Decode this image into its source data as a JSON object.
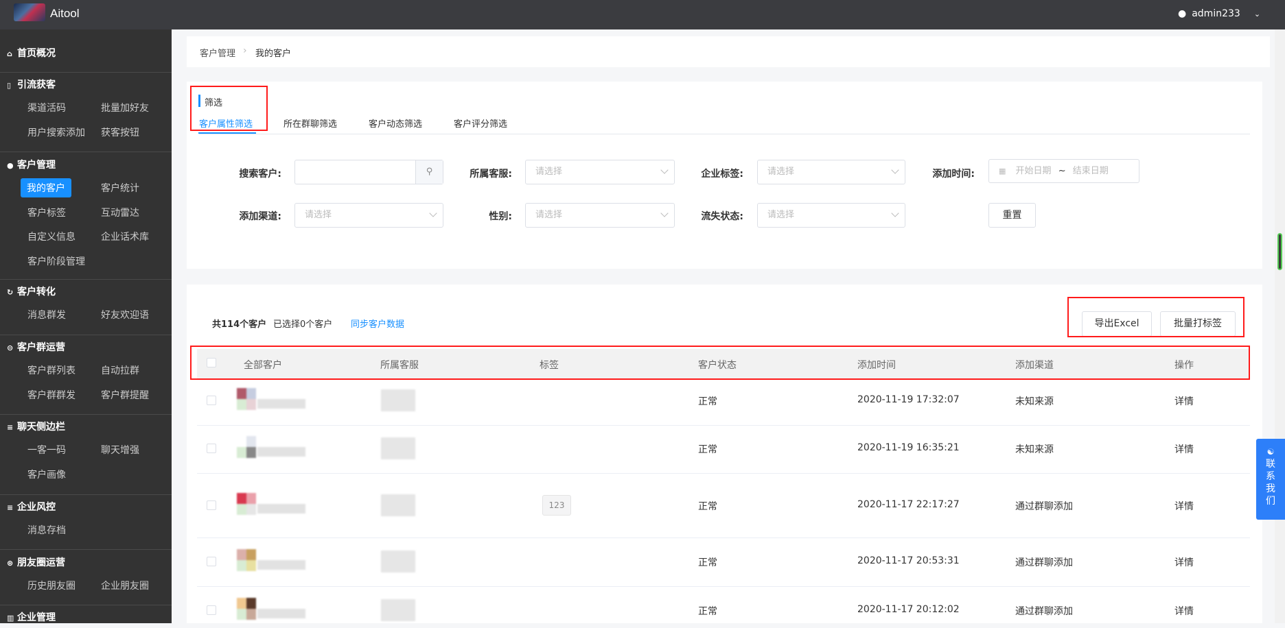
{
  "header": {
    "app_name": "Aitool",
    "username": "admin233"
  },
  "sidebar": {
    "sections": [
      {
        "icon": "home-icon",
        "glyph": "⌂",
        "label": "首页概况",
        "items": []
      },
      {
        "icon": "bookmark-icon",
        "glyph": "▯",
        "label": "引流获客",
        "items": [
          "渠道活码",
          "批量加好友",
          "用户搜索添加",
          "获客按钮"
        ]
      },
      {
        "icon": "user-icon",
        "glyph": "●",
        "label": "客户管理",
        "items": [
          "我的客户",
          "客户统计",
          "客户标签",
          "互动雷达",
          "自定义信息",
          "企业话术库",
          "客户阶段管理"
        ],
        "active": "我的客户"
      },
      {
        "icon": "refresh-icon",
        "glyph": "↻",
        "label": "客户转化",
        "items": [
          "消息群发",
          "好友欢迎语"
        ]
      },
      {
        "icon": "chat-icon",
        "glyph": "⊝",
        "label": "客户群运营",
        "items": [
          "客户群列表",
          "自动拉群",
          "客户群群发",
          "客户群提醒"
        ]
      },
      {
        "icon": "menu-icon",
        "glyph": "≡",
        "label": "聊天侧边栏",
        "items": [
          "一客一码",
          "聊天增强",
          "客户画像"
        ]
      },
      {
        "icon": "menu-icon",
        "glyph": "≡",
        "label": "企业风控",
        "items": [
          "消息存档"
        ]
      },
      {
        "icon": "aperture-icon",
        "glyph": "⊛",
        "label": "朋友圈运营",
        "items": [
          "历史朋友圈",
          "企业朋友圈"
        ]
      },
      {
        "icon": "building-icon",
        "glyph": "▥",
        "label": "企业管理",
        "items": []
      }
    ]
  },
  "breadcrumb": [
    "客户管理",
    "我的客户"
  ],
  "filter": {
    "title": "筛选",
    "tabs": [
      "客户属性筛选",
      "所在群聊筛选",
      "客户动态筛选",
      "客户评分筛选"
    ],
    "active_tab": "客户属性筛选",
    "fields": {
      "search": {
        "label": "搜索客户:",
        "value": ""
      },
      "agent": {
        "label": "所属客服:",
        "placeholder": "请选择"
      },
      "corp_tag": {
        "label": "企业标签:",
        "placeholder": "请选择"
      },
      "add_time": {
        "label": "添加时间:",
        "start": "开始日期",
        "sep": "~",
        "end": "结束日期"
      },
      "channel": {
        "label": "添加渠道:",
        "placeholder": "请选择"
      },
      "gender": {
        "label": "性别:",
        "placeholder": "请选择"
      },
      "churn": {
        "label": "流失状态:",
        "placeholder": "请选择"
      }
    },
    "reset": "重置"
  },
  "table": {
    "total": "共114个客户",
    "selected": "已选择0个客户",
    "sync": "同步客户数据",
    "export": "导出Excel",
    "batch_tag": "批量打标签",
    "columns": [
      "全部客户",
      "所属客服",
      "标签",
      "客户状态",
      "添加时间",
      "添加渠道",
      "操作"
    ],
    "rows": [
      {
        "tag": "",
        "status": "正常",
        "time": "2020-11-19 17:32:07",
        "channel": "未知来源",
        "action": "详情"
      },
      {
        "tag": "",
        "status": "正常",
        "time": "2020-11-19 16:35:21",
        "channel": "未知来源",
        "action": "详情"
      },
      {
        "tag": "123",
        "status": "正常",
        "time": "2020-11-17 22:17:27",
        "channel": "通过群聊添加",
        "action": "详情"
      },
      {
        "tag": "",
        "status": "正常",
        "time": "2020-11-17 20:53:31",
        "channel": "通过群聊添加",
        "action": "详情"
      },
      {
        "tag": "",
        "status": "正常",
        "time": "2020-11-17 20:12:02",
        "channel": "通过群聊添加",
        "action": "详情"
      }
    ]
  },
  "contact": "联系我们",
  "colors": {
    "accent": "#1890ff",
    "header": "#3b3c40",
    "sidebar": "#333333",
    "highlight": "#ff1a1a",
    "contact": "#2d7ff9"
  }
}
